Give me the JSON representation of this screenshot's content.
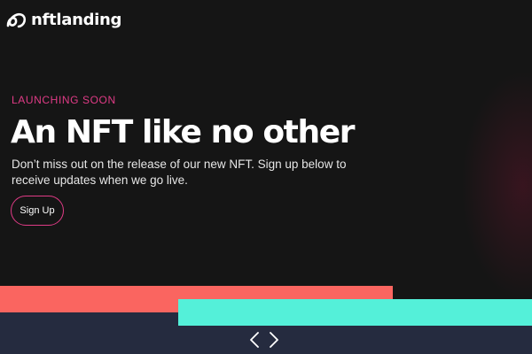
{
  "brand": {
    "logo_icon": "nftlanding-logo-icon",
    "name": "nftlanding"
  },
  "hero": {
    "eyebrow": "LAUNCHING SOON",
    "headline": "An NFT like no other",
    "description": "Don’t miss out on the release of our new NFT. Sign up below to receive updates when we go live.",
    "cta_label": "Sign Up"
  },
  "carousel": {
    "prev_icon": "chevron-left-icon",
    "next_icon": "chevron-right-icon"
  },
  "colors": {
    "background": "#151515",
    "accent_pink": "#e03b86",
    "coral": "#fa6560",
    "teal": "#54f0d9",
    "navy": "#252b3f",
    "text": "#ffffff"
  }
}
